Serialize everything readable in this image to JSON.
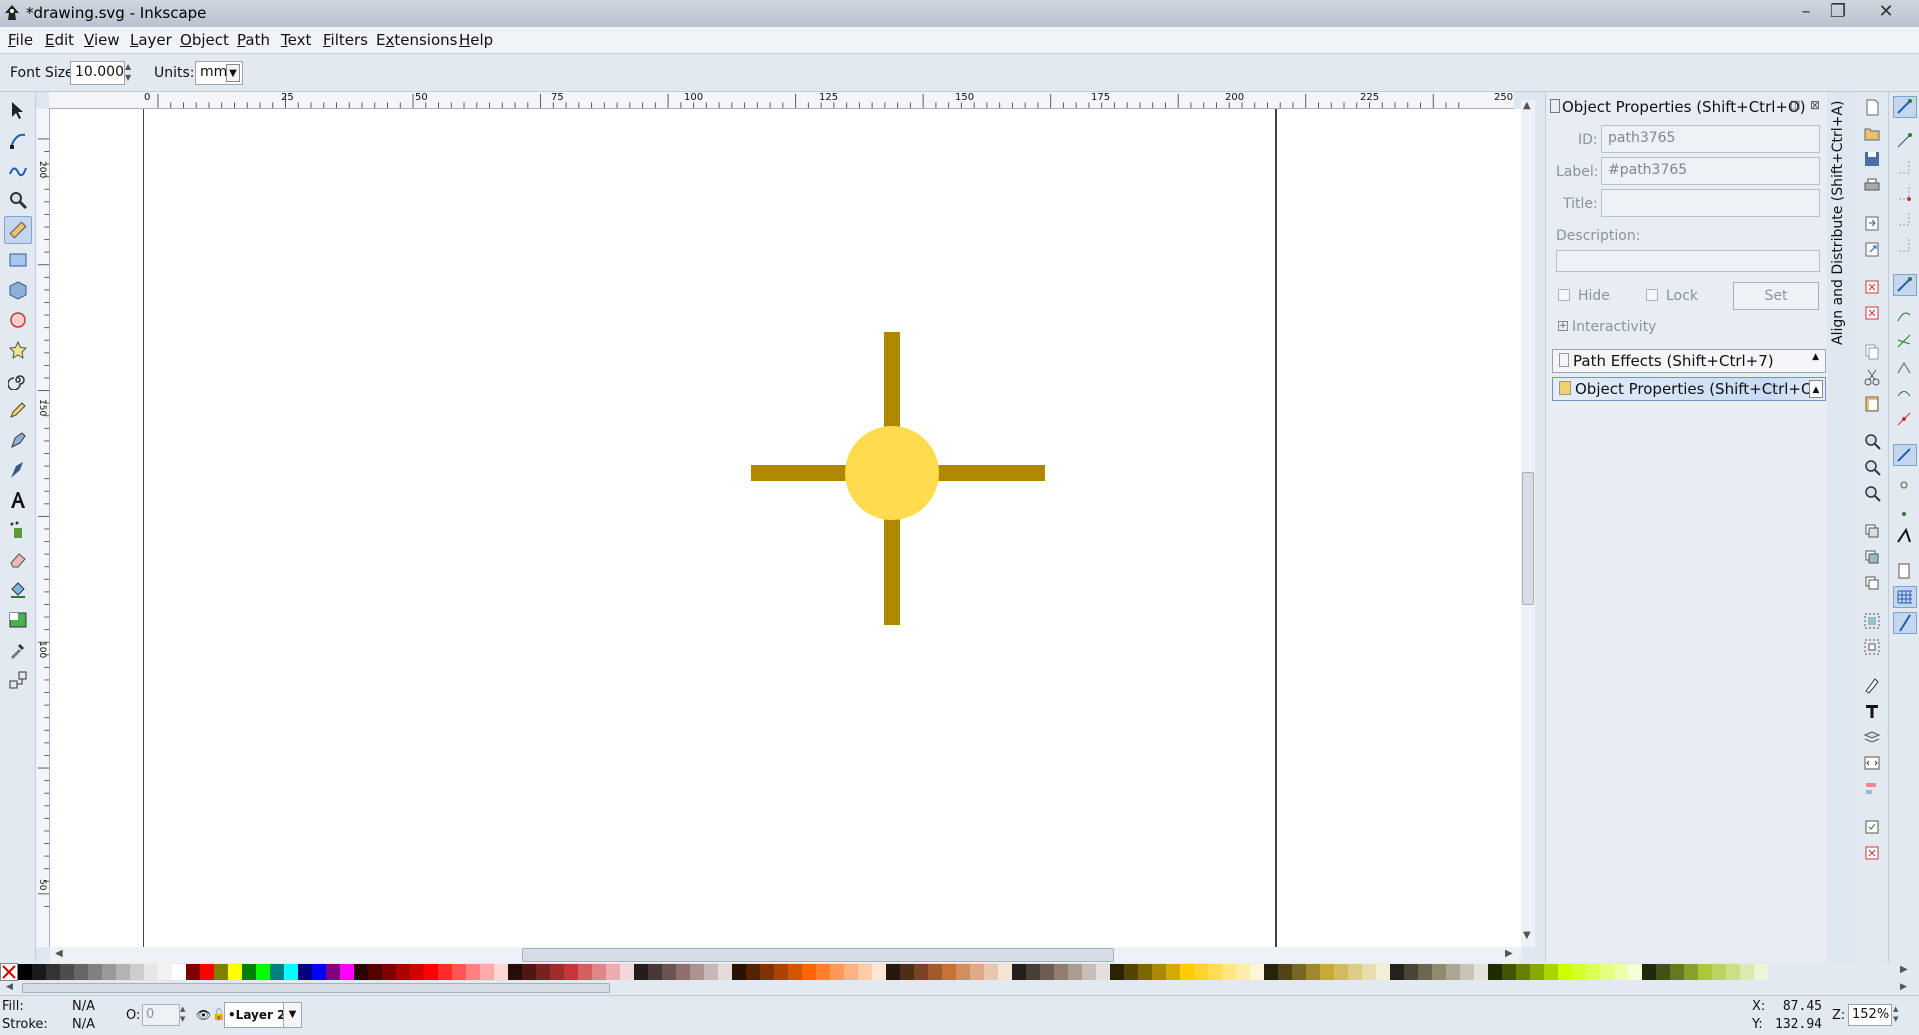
{
  "window": {
    "title": "*drawing.svg - Inkscape"
  },
  "menu": [
    {
      "label": "File",
      "u": "F",
      "rest": "ile"
    },
    {
      "label": "Edit",
      "u": "E",
      "rest": "dit"
    },
    {
      "label": "View",
      "u": "V",
      "rest": "iew"
    },
    {
      "label": "Layer",
      "u": "L",
      "rest": "ayer"
    },
    {
      "label": "Object",
      "u": "O",
      "rest": "bject"
    },
    {
      "label": "Path",
      "u": "P",
      "rest": "ath"
    },
    {
      "label": "Text",
      "u": "T",
      "rest": "ext"
    },
    {
      "label": "Filters",
      "u": "F",
      "rest": "ilters"
    },
    {
      "label": "Extensions",
      "u": "x",
      "pre": "E",
      "rest": "tensions"
    },
    {
      "label": "Help",
      "u": "H",
      "rest": "elp"
    }
  ],
  "toolcontrols": {
    "font_size_label": "Font Size:",
    "font_size_value": "10.000",
    "units_label": "Units:",
    "units_value": "mm"
  },
  "ruler": {
    "h_ticks": [
      "0",
      "25",
      "50",
      "75",
      "100",
      "125",
      "150",
      "175",
      "200",
      "225",
      "250"
    ],
    "v_labels": [
      "200",
      "150",
      "100",
      "50"
    ]
  },
  "dock": {
    "header": "Object Properties (Shift+Ctrl+O)",
    "id_label": "ID:",
    "id_value": "path3765",
    "label_label": "Label:",
    "label_value": "#path3765",
    "title_label": "Title:",
    "title_value": "",
    "description_label": "Description:",
    "hide_label": "Hide",
    "lock_label": "Lock",
    "set_button": "Set",
    "interactivity_label": "Interactivity",
    "path_effects_dropdown": "Path Effects  (Shift+Ctrl+7)",
    "object_props_dropdown": "Object Properties (Shift+Ctrl+O)",
    "vertical_tab": "Align and Distribute (Shift+Ctrl+A)"
  },
  "status": {
    "fill_label": "Fill:",
    "fill_value": "N/A",
    "stroke_label": "Stroke:",
    "stroke_value": "N/A",
    "opacity_label": "O:",
    "opacity_value": "0",
    "layer_name": "•Layer 2",
    "x_label": "X:",
    "x_value": "87.45",
    "y_label": "Y:",
    "y_value": "132.94",
    "zoom_label": "Z:",
    "zoom_value": "152%"
  },
  "drawing": {
    "circle_color": "#ffdb4d",
    "ray_color": "#b08800"
  },
  "palette_colors": [
    "#000000",
    "#1a1a1a",
    "#333333",
    "#4d4d4d",
    "#666666",
    "#808080",
    "#999999",
    "#b3b3b3",
    "#cccccc",
    "#e6e6e6",
    "#f2f2f2",
    "#ffffff",
    "#800000",
    "#ff0000",
    "#808000",
    "#ffff00",
    "#008000",
    "#00ff00",
    "#008080",
    "#00ffff",
    "#000080",
    "#0000ff",
    "#800080",
    "#ff00ff",
    "#2b0000",
    "#550000",
    "#800000",
    "#aa0000",
    "#d40000",
    "#ff0000",
    "#ff2a2a",
    "#ff5555",
    "#ff8080",
    "#ffaaaa",
    "#ffd5d5",
    "#280b0b",
    "#501616",
    "#782121",
    "#a02c2c",
    "#c83737",
    "#d35f5f",
    "#de8787",
    "#e9afaf",
    "#f4d7d7",
    "#241c1c",
    "#483737",
    "#6c5353",
    "#916f6f",
    "#ac9393",
    "#c8b7b7",
    "#e3dbdb",
    "#2b1100",
    "#552200",
    "#803300",
    "#aa4400",
    "#d45500",
    "#ff6600",
    "#ff7f2a",
    "#ff9955",
    "#ffb380",
    "#ffccaa",
    "#ffe6d5",
    "#28170b",
    "#502d16",
    "#784421",
    "#a05a2c",
    "#c87137",
    "#d38d5f",
    "#deaa87",
    "#e9c6af",
    "#f4e3d7",
    "#241f1c",
    "#483e37",
    "#6c5d53",
    "#917c6f",
    "#ac9d93",
    "#c8beb7",
    "#e3dedb",
    "#2b2200",
    "#554400",
    "#806600",
    "#aa8800",
    "#d4aa00",
    "#ffcc00",
    "#ffd42a",
    "#ffdd55",
    "#ffe680",
    "#ffeeaa",
    "#fff6d5",
    "#28220b",
    "#504416",
    "#786721",
    "#a0892c",
    "#c8ab37",
    "#d3bc5f",
    "#decd87",
    "#e9ddaf",
    "#f4eed7",
    "#24221c",
    "#484537",
    "#6c6753",
    "#918a6f",
    "#aca793",
    "#c8c4b7",
    "#e3e2db",
    "#222b00",
    "#445500",
    "#668000",
    "#88aa00",
    "#aad400",
    "#ccff00",
    "#d4ff2a",
    "#ddff55",
    "#e5ff80",
    "#eeffaa",
    "#f6ffd5",
    "#22280b",
    "#445016",
    "#677821",
    "#89a02c",
    "#abc837",
    "#bcd35f",
    "#cdde87",
    "#dde9af",
    "#eef4d7"
  ]
}
